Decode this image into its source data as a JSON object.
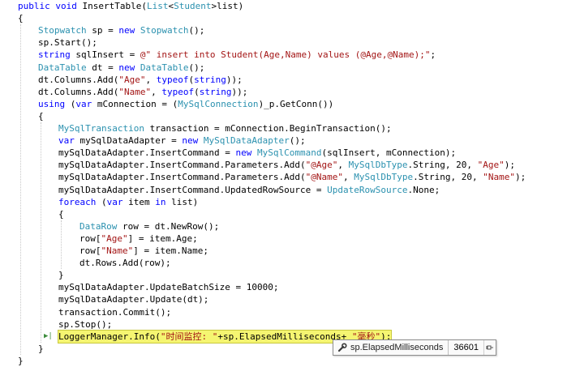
{
  "lines": [
    {
      "indent": 1,
      "tokens": [
        [
          "kw",
          "public"
        ],
        [
          "t",
          " "
        ],
        [
          "kw",
          "void"
        ],
        [
          "t",
          " InsertTable("
        ],
        [
          "ty",
          "List"
        ],
        [
          "t",
          "<"
        ],
        [
          "ty",
          "Student"
        ],
        [
          "t",
          ">list)"
        ]
      ]
    },
    {
      "indent": 1,
      "tokens": [
        [
          "t",
          "{"
        ]
      ]
    },
    {
      "indent": 2,
      "tokens": [
        [
          "ty",
          "Stopwatch"
        ],
        [
          "t",
          " sp = "
        ],
        [
          "kw",
          "new"
        ],
        [
          "t",
          " "
        ],
        [
          "ty",
          "Stopwatch"
        ],
        [
          "t",
          "();"
        ]
      ]
    },
    {
      "indent": 2,
      "tokens": [
        [
          "t",
          "sp.Start();"
        ]
      ]
    },
    {
      "indent": 2,
      "tokens": [
        [
          "kw",
          "string"
        ],
        [
          "t",
          " sqlInsert = "
        ],
        [
          "str",
          "@\" insert into Student(Age,Name) values (@Age,@Name);\""
        ],
        [
          "t",
          ";"
        ]
      ]
    },
    {
      "indent": 2,
      "tokens": [
        [
          "ty",
          "DataTable"
        ],
        [
          "t",
          " dt = "
        ],
        [
          "kw",
          "new"
        ],
        [
          "t",
          " "
        ],
        [
          "ty",
          "DataTable"
        ],
        [
          "t",
          "();"
        ]
      ]
    },
    {
      "indent": 2,
      "tokens": [
        [
          "t",
          "dt.Columns.Add("
        ],
        [
          "str",
          "\"Age\""
        ],
        [
          "t",
          ", "
        ],
        [
          "kw",
          "typeof"
        ],
        [
          "t",
          "("
        ],
        [
          "kw",
          "string"
        ],
        [
          "t",
          "));"
        ]
      ]
    },
    {
      "indent": 2,
      "tokens": [
        [
          "t",
          "dt.Columns.Add("
        ],
        [
          "str",
          "\"Name\""
        ],
        [
          "t",
          ", "
        ],
        [
          "kw",
          "typeof"
        ],
        [
          "t",
          "("
        ],
        [
          "kw",
          "string"
        ],
        [
          "t",
          "));"
        ]
      ]
    },
    {
      "indent": 2,
      "tokens": [
        [
          "kw",
          "using"
        ],
        [
          "t",
          " ("
        ],
        [
          "kw",
          "var"
        ],
        [
          "t",
          " mConnection = ("
        ],
        [
          "ty",
          "MySqlConnection"
        ],
        [
          "t",
          ")_p.GetConn())"
        ]
      ]
    },
    {
      "indent": 2,
      "tokens": [
        [
          "t",
          "{"
        ]
      ]
    },
    {
      "indent": 3,
      "tokens": [
        [
          "ty",
          "MySqlTransaction"
        ],
        [
          "t",
          " transaction = mConnection.BeginTransaction();"
        ]
      ]
    },
    {
      "indent": 3,
      "tokens": [
        [
          "kw",
          "var"
        ],
        [
          "t",
          " mySqlDataAdapter = "
        ],
        [
          "kw",
          "new"
        ],
        [
          "t",
          " "
        ],
        [
          "ty",
          "MySqlDataAdapter"
        ],
        [
          "t",
          "();"
        ]
      ]
    },
    {
      "indent": 3,
      "tokens": [
        [
          "t",
          "mySqlDataAdapter.InsertCommand = "
        ],
        [
          "kw",
          "new"
        ],
        [
          "t",
          " "
        ],
        [
          "ty",
          "MySqlCommand"
        ],
        [
          "t",
          "(sqlInsert, mConnection);"
        ]
      ]
    },
    {
      "indent": 3,
      "tokens": [
        [
          "t",
          "mySqlDataAdapter.InsertCommand.Parameters.Add("
        ],
        [
          "str",
          "\"@Age\""
        ],
        [
          "t",
          ", "
        ],
        [
          "ty",
          "MySqlDbType"
        ],
        [
          "t",
          ".String, 20, "
        ],
        [
          "str",
          "\"Age\""
        ],
        [
          "t",
          ");"
        ]
      ]
    },
    {
      "indent": 3,
      "tokens": [
        [
          "t",
          "mySqlDataAdapter.InsertCommand.Parameters.Add("
        ],
        [
          "str",
          "\"@Name\""
        ],
        [
          "t",
          ", "
        ],
        [
          "ty",
          "MySqlDbType"
        ],
        [
          "t",
          ".String, 20, "
        ],
        [
          "str",
          "\"Name\""
        ],
        [
          "t",
          ");"
        ]
      ]
    },
    {
      "indent": 3,
      "tokens": [
        [
          "t",
          "mySqlDataAdapter.InsertCommand.UpdatedRowSource = "
        ],
        [
          "ty",
          "UpdateRowSource"
        ],
        [
          "t",
          ".None;"
        ]
      ]
    },
    {
      "indent": 3,
      "tokens": [
        [
          "kw",
          "foreach"
        ],
        [
          "t",
          " ("
        ],
        [
          "kw",
          "var"
        ],
        [
          "t",
          " item "
        ],
        [
          "kw",
          "in"
        ],
        [
          "t",
          " list)"
        ]
      ]
    },
    {
      "indent": 3,
      "tokens": [
        [
          "t",
          "{"
        ]
      ]
    },
    {
      "indent": 4,
      "tokens": [
        [
          "ty",
          "DataRow"
        ],
        [
          "t",
          " row = dt.NewRow();"
        ]
      ]
    },
    {
      "indent": 4,
      "tokens": [
        [
          "t",
          "row["
        ],
        [
          "str",
          "\"Age\""
        ],
        [
          "t",
          "] = item.Age;"
        ]
      ]
    },
    {
      "indent": 4,
      "tokens": [
        [
          "t",
          "row["
        ],
        [
          "str",
          "\"Name\""
        ],
        [
          "t",
          "] = item.Name;"
        ]
      ]
    },
    {
      "indent": 4,
      "tokens": [
        [
          "t",
          "dt.Rows.Add(row);"
        ]
      ]
    },
    {
      "indent": 3,
      "tokens": [
        [
          "t",
          "}"
        ]
      ]
    },
    {
      "indent": 3,
      "tokens": [
        [
          "t",
          "mySqlDataAdapter.UpdateBatchSize = 10000;"
        ]
      ]
    },
    {
      "indent": 3,
      "tokens": [
        [
          "t",
          "mySqlDataAdapter.Update(dt);"
        ]
      ]
    },
    {
      "indent": 3,
      "tokens": [
        [
          "t",
          "transaction.Commit();"
        ]
      ]
    },
    {
      "indent": 3,
      "tokens": [
        [
          "t",
          "sp.Stop();"
        ]
      ]
    },
    {
      "indent": 3,
      "current": true,
      "tokens": [
        [
          "t",
          "LoggerManager.Info("
        ],
        [
          "str",
          "\"时间监控: \""
        ],
        [
          "t",
          "+sp.ElapsedMilliseconds+ "
        ],
        [
          "str",
          "\"毫秒\""
        ],
        [
          "t",
          ");"
        ]
      ]
    },
    {
      "indent": 2,
      "tokens": [
        [
          "t",
          "}"
        ]
      ]
    },
    {
      "indent": 1,
      "tokens": [
        [
          "t",
          "}"
        ]
      ]
    }
  ],
  "datatip": {
    "expression": "sp.ElapsedMilliseconds",
    "value": "36601",
    "icon": "wrench-icon",
    "pin_icon": "pin-icon"
  },
  "colors": {
    "keyword": "#0000ff",
    "type": "#2b91af",
    "string": "#a31515",
    "current_line": "#ffff9e"
  }
}
